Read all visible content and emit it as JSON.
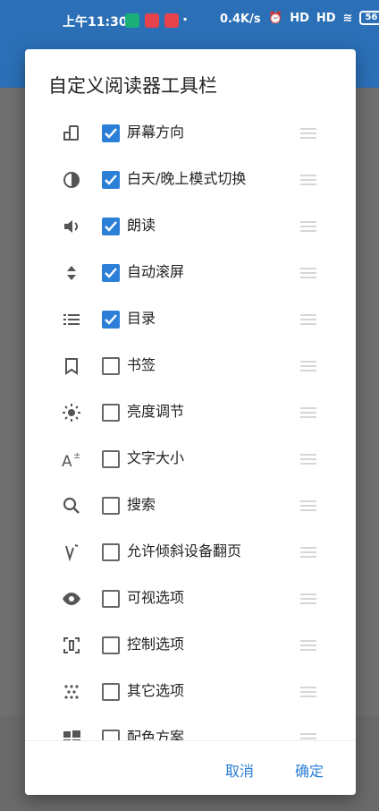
{
  "status_bar": {
    "time": "上午11:30",
    "net_speed": "0.4K/s",
    "signal1": "HD",
    "signal2": "HD",
    "battery": "56",
    "badges": [
      "#1bb07a",
      "#e6434d",
      "#e6434d"
    ],
    "dot": "·"
  },
  "dialog": {
    "title": "自定义阅读器工具栏",
    "items": [
      {
        "label": "屏幕方向",
        "checked": true,
        "icon": "screen-rotation-icon"
      },
      {
        "label": "白天/晚上模式切换",
        "checked": true,
        "icon": "day-night-icon"
      },
      {
        "label": "朗读",
        "checked": true,
        "icon": "speaker-icon"
      },
      {
        "label": "自动滚屏",
        "checked": true,
        "icon": "auto-scroll-icon"
      },
      {
        "label": "目录",
        "checked": true,
        "icon": "toc-icon"
      },
      {
        "label": "书签",
        "checked": false,
        "icon": "bookmark-icon"
      },
      {
        "label": "亮度调节",
        "checked": false,
        "icon": "brightness-icon"
      },
      {
        "label": "文字大小",
        "checked": false,
        "icon": "font-size-icon"
      },
      {
        "label": "搜索",
        "checked": false,
        "icon": "search-icon"
      },
      {
        "label": "允许倾斜设备翻页",
        "checked": false,
        "icon": "tilt-icon"
      },
      {
        "label": "可视选项",
        "checked": false,
        "icon": "eye-icon"
      },
      {
        "label": "控制选项",
        "checked": false,
        "icon": "control-icon"
      },
      {
        "label": "其它选项",
        "checked": false,
        "icon": "dots-icon"
      },
      {
        "label": "配色方案",
        "checked": false,
        "icon": "color-scheme-icon"
      }
    ],
    "cancel_label": "取消",
    "ok_label": "确定"
  },
  "colors": {
    "accent": "#2b7fd6",
    "app_bar": "#2b6fb6"
  }
}
